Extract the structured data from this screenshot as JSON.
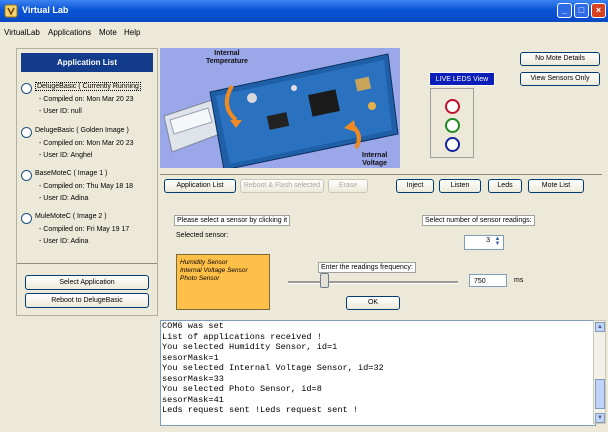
{
  "window": {
    "title": "Virtual Lab"
  },
  "menu": [
    "VirtualLab",
    "Applications",
    "Mote",
    "Help"
  ],
  "app_list": {
    "header": "Application List",
    "items": [
      {
        "name": "DelugeBasic ( Currently Running",
        "compiled": "- Compiled on: Mon Mar 20 23",
        "user": "- User ID: null",
        "selected": true
      },
      {
        "name": "DelugeBasic ( Golden Image )",
        "compiled": "- Compiled on: Mon Mar 20 23",
        "user": "- User ID: Anghel",
        "selected": false
      },
      {
        "name": "BaseMoteC ( Image 1 )",
        "compiled": "- Compiled on: Thu May 18 18",
        "user": "- User ID: Adina",
        "selected": false
      },
      {
        "name": "MuleMoteC ( Image 2 )",
        "compiled": "- Compiled on: Fri May 19 17",
        "user": "- User ID: Adina",
        "selected": false
      }
    ],
    "select_button": "Select Application",
    "reboot_button": "Reboot to DelugeBasic"
  },
  "picture": {
    "label_temp": "Internal\nTemperature",
    "label_voltage": "Internal\nVoltage"
  },
  "led_view": {
    "title": "LIVE LEDS View",
    "leds": [
      "#c0102a",
      "#1e8a1e",
      "#1022a0"
    ]
  },
  "right_buttons": {
    "mote_details": "No Mote Details",
    "view_sensors": "View Sensors Only"
  },
  "toolbar": {
    "app_list": "Application List",
    "reboot_flash": "Reboot & Flash selected",
    "erase": "Erase",
    "inject": "Inject",
    "listen": "Listen",
    "leds": "Leds",
    "mote_list": "Mote List"
  },
  "sensors": {
    "prompt": "Please select a sensor by clicking it",
    "selected_label": "Selected sensor:",
    "list": [
      "Humidity Sensor",
      "Internal Voltage Sensor",
      "Photo Sensor"
    ],
    "readings_label": "Select number of sensor readings:",
    "readings_value": "3",
    "frequency_label": "Enter the readings frequency:",
    "frequency_value": "750",
    "frequency_unit": "ms",
    "ok": "OK"
  },
  "console_lines": [
    "COM6 was set",
    "List of applications received !",
    "You selected Humidity Sensor, id=1",
    "sesorMask=1",
    "You selected Internal Voltage Sensor, id=32",
    "sesorMask=33",
    "You selected Photo Sensor, id=8",
    "sesorMask=41",
    "Leds request sent !Leds request sent !"
  ]
}
